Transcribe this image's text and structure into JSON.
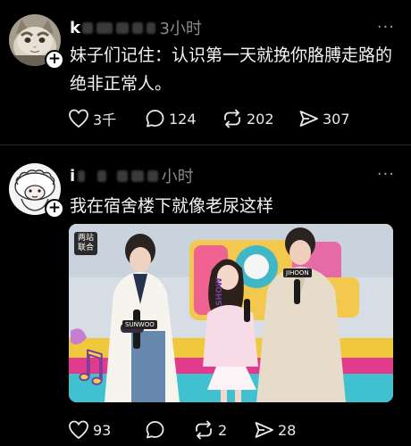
{
  "post1": {
    "username": "k",
    "time": "3小时",
    "content": "妹子们记住：认识第一天就挽你胳膊走路的绝非正常人。",
    "likes": "3千",
    "comments": "124",
    "reposts": "202",
    "shares": "307"
  },
  "post2": {
    "username": "i",
    "time": "小时",
    "content": "我在宿舍楼下就像老尿这样",
    "media": {
      "watermark": "两站联合",
      "show_text": "SHOW",
      "tag_left": "SUNWOO",
      "tag_right": "JIHOON"
    },
    "likes": "93",
    "comments": "",
    "reposts": "2",
    "shares": "28"
  },
  "colors": {
    "background": "#000000",
    "text": "#f3f3f3",
    "muted": "#8a8a8a",
    "divider": "#262626"
  },
  "icons": [
    "heart-icon",
    "comment-icon",
    "repost-icon",
    "share-icon",
    "more-icon",
    "follow-plus-icon"
  ]
}
